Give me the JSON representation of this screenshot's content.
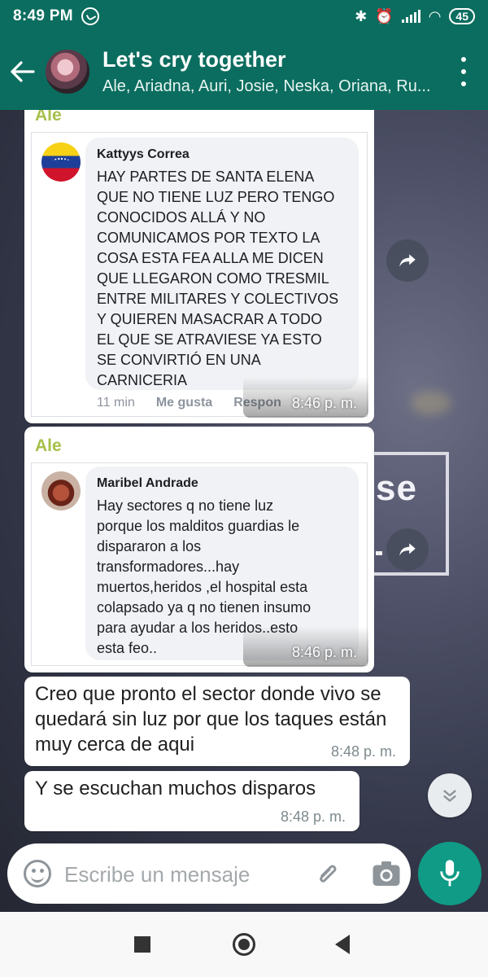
{
  "status_bar": {
    "time": "8:49 PM",
    "battery": "45"
  },
  "header": {
    "group_name": "Let's cry together",
    "members": "Ale, Ariadna, Auri, Josie, Neska, Oriana, Ru..."
  },
  "messages": [
    {
      "sender": "Ale",
      "type": "image",
      "image": {
        "commenter": "Kattyys Correa",
        "comment": "HAY PARTES DE SANTA ELENA\nQUE NO TIENE LUZ PERO TENGO\nCONOCIDOS ALLÁ Y NO\nCOMUNICAMOS POR TEXTO LA\nCOSA ESTA FEA ALLA ME DICEN\nQUE LLEGARON COMO TRESMIL\nENTRE MILITARES Y COLECTIVOS\nY QUIEREN MASACRAR A TODO\nEL QUE SE ATRAVIESE YA ESTO\nSE CONVIRTIÓ EN UNA\nCARNICERIA",
        "ago": "11 min",
        "like": "Me gusta",
        "reply": "Respon"
      },
      "time": "8:46 p. m."
    },
    {
      "sender": "Ale",
      "type": "image",
      "image": {
        "commenter": "Maribel Andrade",
        "comment": "Hay sectores q no tiene luz\nporque los malditos guardias le\ndispararon a los\ntransformadores...hay\nmuertos,heridos ,el hospital esta\ncolapsado ya q no tienen insumo\npara ayudar a los heridos..esto\nesta feo.."
      },
      "time": "8:46 p. m."
    },
    {
      "type": "text",
      "text": "Creo que pronto el sector donde vivo se quedará sin luz por que los taques están muy cerca de aqui",
      "time": "8:48 p. m."
    },
    {
      "type": "text",
      "text": "Y se escuchan muchos disparos",
      "time": "8:48 p. m."
    }
  ],
  "background_text": "se",
  "input": {
    "placeholder": "Escribe un mensaje"
  },
  "colors": {
    "header": "#0b6d5f",
    "accent": "#0f9b86",
    "sender": "#a6c04a"
  },
  "icons": [
    "back-arrow-icon",
    "menu-icon",
    "forward-icon",
    "scroll-down-icon",
    "emoji-icon",
    "attach-icon",
    "camera-icon",
    "mic-icon"
  ]
}
